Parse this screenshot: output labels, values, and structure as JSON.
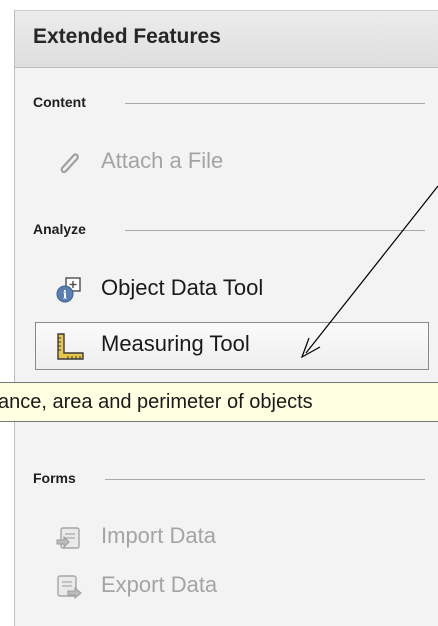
{
  "panel": {
    "title": "Extended Features"
  },
  "sections": {
    "content": {
      "label": "Content",
      "items": [
        {
          "label": "Attach a File",
          "icon": "paperclip-icon",
          "enabled": false
        }
      ]
    },
    "analyze": {
      "label": "Analyze",
      "items": [
        {
          "label": "Object Data Tool",
          "icon": "object-data-icon",
          "enabled": true
        },
        {
          "label": "Measuring Tool",
          "icon": "ruler-icon",
          "enabled": true,
          "selected": true
        }
      ]
    },
    "forms": {
      "label": "Forms",
      "items": [
        {
          "label": "Import Data",
          "icon": "import-data-icon",
          "enabled": false
        },
        {
          "label": "Export Data",
          "icon": "export-data-icon",
          "enabled": false
        }
      ]
    }
  },
  "tooltip": {
    "text": "ance, area and perimeter of objects"
  },
  "colors": {
    "panel_background": "#f3f3f3",
    "header_background": "#e4e4e4",
    "tooltip_background": "#ffffe1",
    "disabled_text": "#a4a4a4",
    "enabled_text": "#1a1a1a",
    "annotation_arrow": "#000000"
  }
}
